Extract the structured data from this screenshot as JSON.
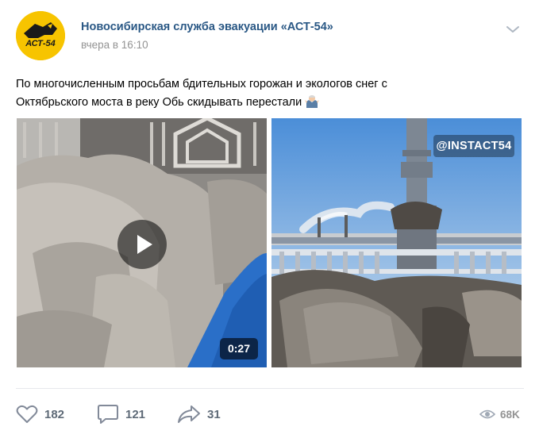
{
  "post": {
    "author": "Новосибирская служба эвакуации «АСТ-54»",
    "date": "вчера в 16:10",
    "text": "По многочисленным просьбам бдительных горожан и экологов снег с Октябрьского моста в реку Обь скидывать перестали",
    "avatar_text": "АСТ-54",
    "avatar_color": "#f7c400",
    "author_color": "#2a5885"
  },
  "media": {
    "video": {
      "duration": "0:27",
      "play_icon": "play-icon"
    },
    "photo": {
      "watermark": "@INSTACT54"
    }
  },
  "actions": {
    "likes": "182",
    "comments": "121",
    "shares": "31",
    "views": "68K",
    "icon_color": "#828a99"
  }
}
